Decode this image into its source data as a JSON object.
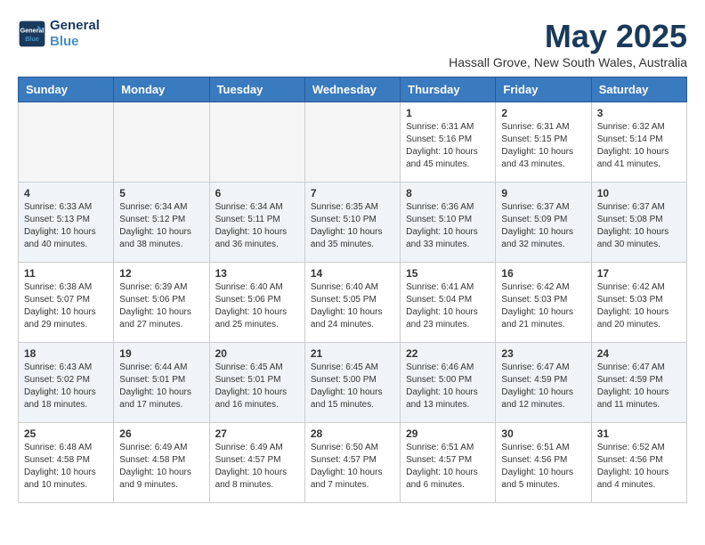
{
  "logo": {
    "line1": "General",
    "line2": "Blue"
  },
  "title": "May 2025",
  "location": "Hassall Grove, New South Wales, Australia",
  "weekdays": [
    "Sunday",
    "Monday",
    "Tuesday",
    "Wednesday",
    "Thursday",
    "Friday",
    "Saturday"
  ],
  "weeks": [
    [
      {
        "day": "",
        "info": ""
      },
      {
        "day": "",
        "info": ""
      },
      {
        "day": "",
        "info": ""
      },
      {
        "day": "",
        "info": ""
      },
      {
        "day": "1",
        "info": "Sunrise: 6:31 AM\nSunset: 5:16 PM\nDaylight: 10 hours\nand 45 minutes."
      },
      {
        "day": "2",
        "info": "Sunrise: 6:31 AM\nSunset: 5:15 PM\nDaylight: 10 hours\nand 43 minutes."
      },
      {
        "day": "3",
        "info": "Sunrise: 6:32 AM\nSunset: 5:14 PM\nDaylight: 10 hours\nand 41 minutes."
      }
    ],
    [
      {
        "day": "4",
        "info": "Sunrise: 6:33 AM\nSunset: 5:13 PM\nDaylight: 10 hours\nand 40 minutes."
      },
      {
        "day": "5",
        "info": "Sunrise: 6:34 AM\nSunset: 5:12 PM\nDaylight: 10 hours\nand 38 minutes."
      },
      {
        "day": "6",
        "info": "Sunrise: 6:34 AM\nSunset: 5:11 PM\nDaylight: 10 hours\nand 36 minutes."
      },
      {
        "day": "7",
        "info": "Sunrise: 6:35 AM\nSunset: 5:10 PM\nDaylight: 10 hours\nand 35 minutes."
      },
      {
        "day": "8",
        "info": "Sunrise: 6:36 AM\nSunset: 5:10 PM\nDaylight: 10 hours\nand 33 minutes."
      },
      {
        "day": "9",
        "info": "Sunrise: 6:37 AM\nSunset: 5:09 PM\nDaylight: 10 hours\nand 32 minutes."
      },
      {
        "day": "10",
        "info": "Sunrise: 6:37 AM\nSunset: 5:08 PM\nDaylight: 10 hours\nand 30 minutes."
      }
    ],
    [
      {
        "day": "11",
        "info": "Sunrise: 6:38 AM\nSunset: 5:07 PM\nDaylight: 10 hours\nand 29 minutes."
      },
      {
        "day": "12",
        "info": "Sunrise: 6:39 AM\nSunset: 5:06 PM\nDaylight: 10 hours\nand 27 minutes."
      },
      {
        "day": "13",
        "info": "Sunrise: 6:40 AM\nSunset: 5:06 PM\nDaylight: 10 hours\nand 25 minutes."
      },
      {
        "day": "14",
        "info": "Sunrise: 6:40 AM\nSunset: 5:05 PM\nDaylight: 10 hours\nand 24 minutes."
      },
      {
        "day": "15",
        "info": "Sunrise: 6:41 AM\nSunset: 5:04 PM\nDaylight: 10 hours\nand 23 minutes."
      },
      {
        "day": "16",
        "info": "Sunrise: 6:42 AM\nSunset: 5:03 PM\nDaylight: 10 hours\nand 21 minutes."
      },
      {
        "day": "17",
        "info": "Sunrise: 6:42 AM\nSunset: 5:03 PM\nDaylight: 10 hours\nand 20 minutes."
      }
    ],
    [
      {
        "day": "18",
        "info": "Sunrise: 6:43 AM\nSunset: 5:02 PM\nDaylight: 10 hours\nand 18 minutes."
      },
      {
        "day": "19",
        "info": "Sunrise: 6:44 AM\nSunset: 5:01 PM\nDaylight: 10 hours\nand 17 minutes."
      },
      {
        "day": "20",
        "info": "Sunrise: 6:45 AM\nSunset: 5:01 PM\nDaylight: 10 hours\nand 16 minutes."
      },
      {
        "day": "21",
        "info": "Sunrise: 6:45 AM\nSunset: 5:00 PM\nDaylight: 10 hours\nand 15 minutes."
      },
      {
        "day": "22",
        "info": "Sunrise: 6:46 AM\nSunset: 5:00 PM\nDaylight: 10 hours\nand 13 minutes."
      },
      {
        "day": "23",
        "info": "Sunrise: 6:47 AM\nSunset: 4:59 PM\nDaylight: 10 hours\nand 12 minutes."
      },
      {
        "day": "24",
        "info": "Sunrise: 6:47 AM\nSunset: 4:59 PM\nDaylight: 10 hours\nand 11 minutes."
      }
    ],
    [
      {
        "day": "25",
        "info": "Sunrise: 6:48 AM\nSunset: 4:58 PM\nDaylight: 10 hours\nand 10 minutes."
      },
      {
        "day": "26",
        "info": "Sunrise: 6:49 AM\nSunset: 4:58 PM\nDaylight: 10 hours\nand 9 minutes."
      },
      {
        "day": "27",
        "info": "Sunrise: 6:49 AM\nSunset: 4:57 PM\nDaylight: 10 hours\nand 8 minutes."
      },
      {
        "day": "28",
        "info": "Sunrise: 6:50 AM\nSunset: 4:57 PM\nDaylight: 10 hours\nand 7 minutes."
      },
      {
        "day": "29",
        "info": "Sunrise: 6:51 AM\nSunset: 4:57 PM\nDaylight: 10 hours\nand 6 minutes."
      },
      {
        "day": "30",
        "info": "Sunrise: 6:51 AM\nSunset: 4:56 PM\nDaylight: 10 hours\nand 5 minutes."
      },
      {
        "day": "31",
        "info": "Sunrise: 6:52 AM\nSunset: 4:56 PM\nDaylight: 10 hours\nand 4 minutes."
      }
    ]
  ]
}
